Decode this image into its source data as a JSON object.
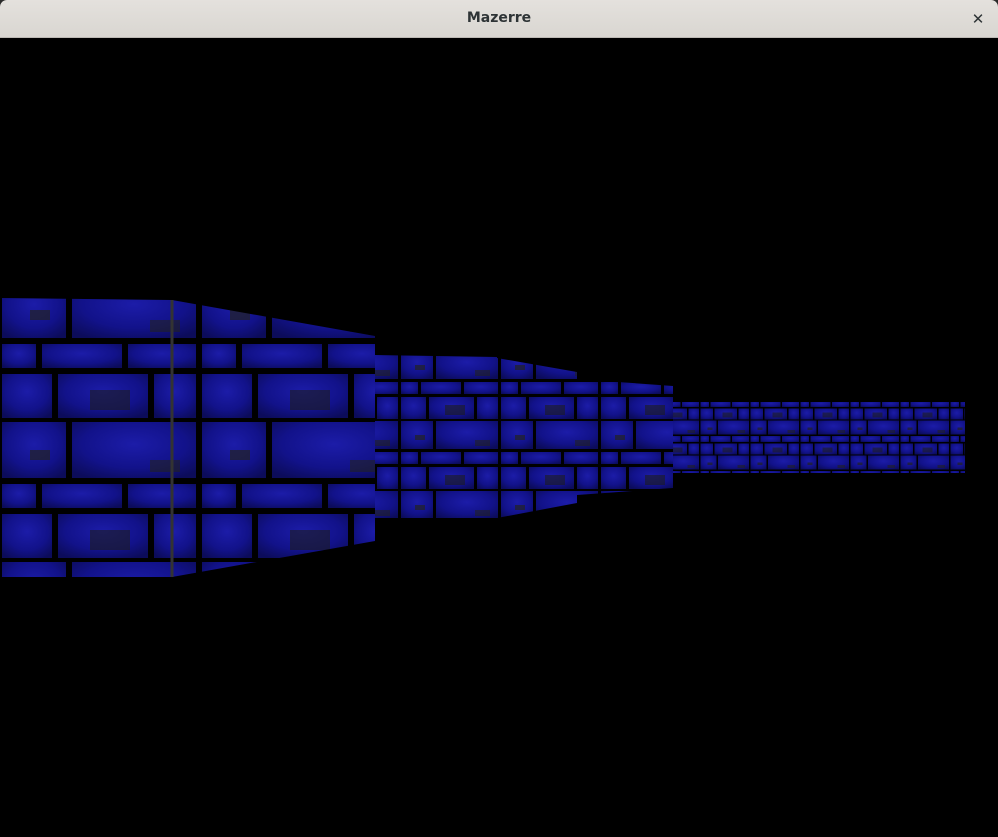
{
  "window": {
    "title": "Mazerre",
    "close_icon": "close-icon"
  },
  "scene": {
    "wall_color": "#1a1a8c",
    "mortar_color": "#000000",
    "ceiling_color": "#000000",
    "floor_color": "#000000"
  }
}
